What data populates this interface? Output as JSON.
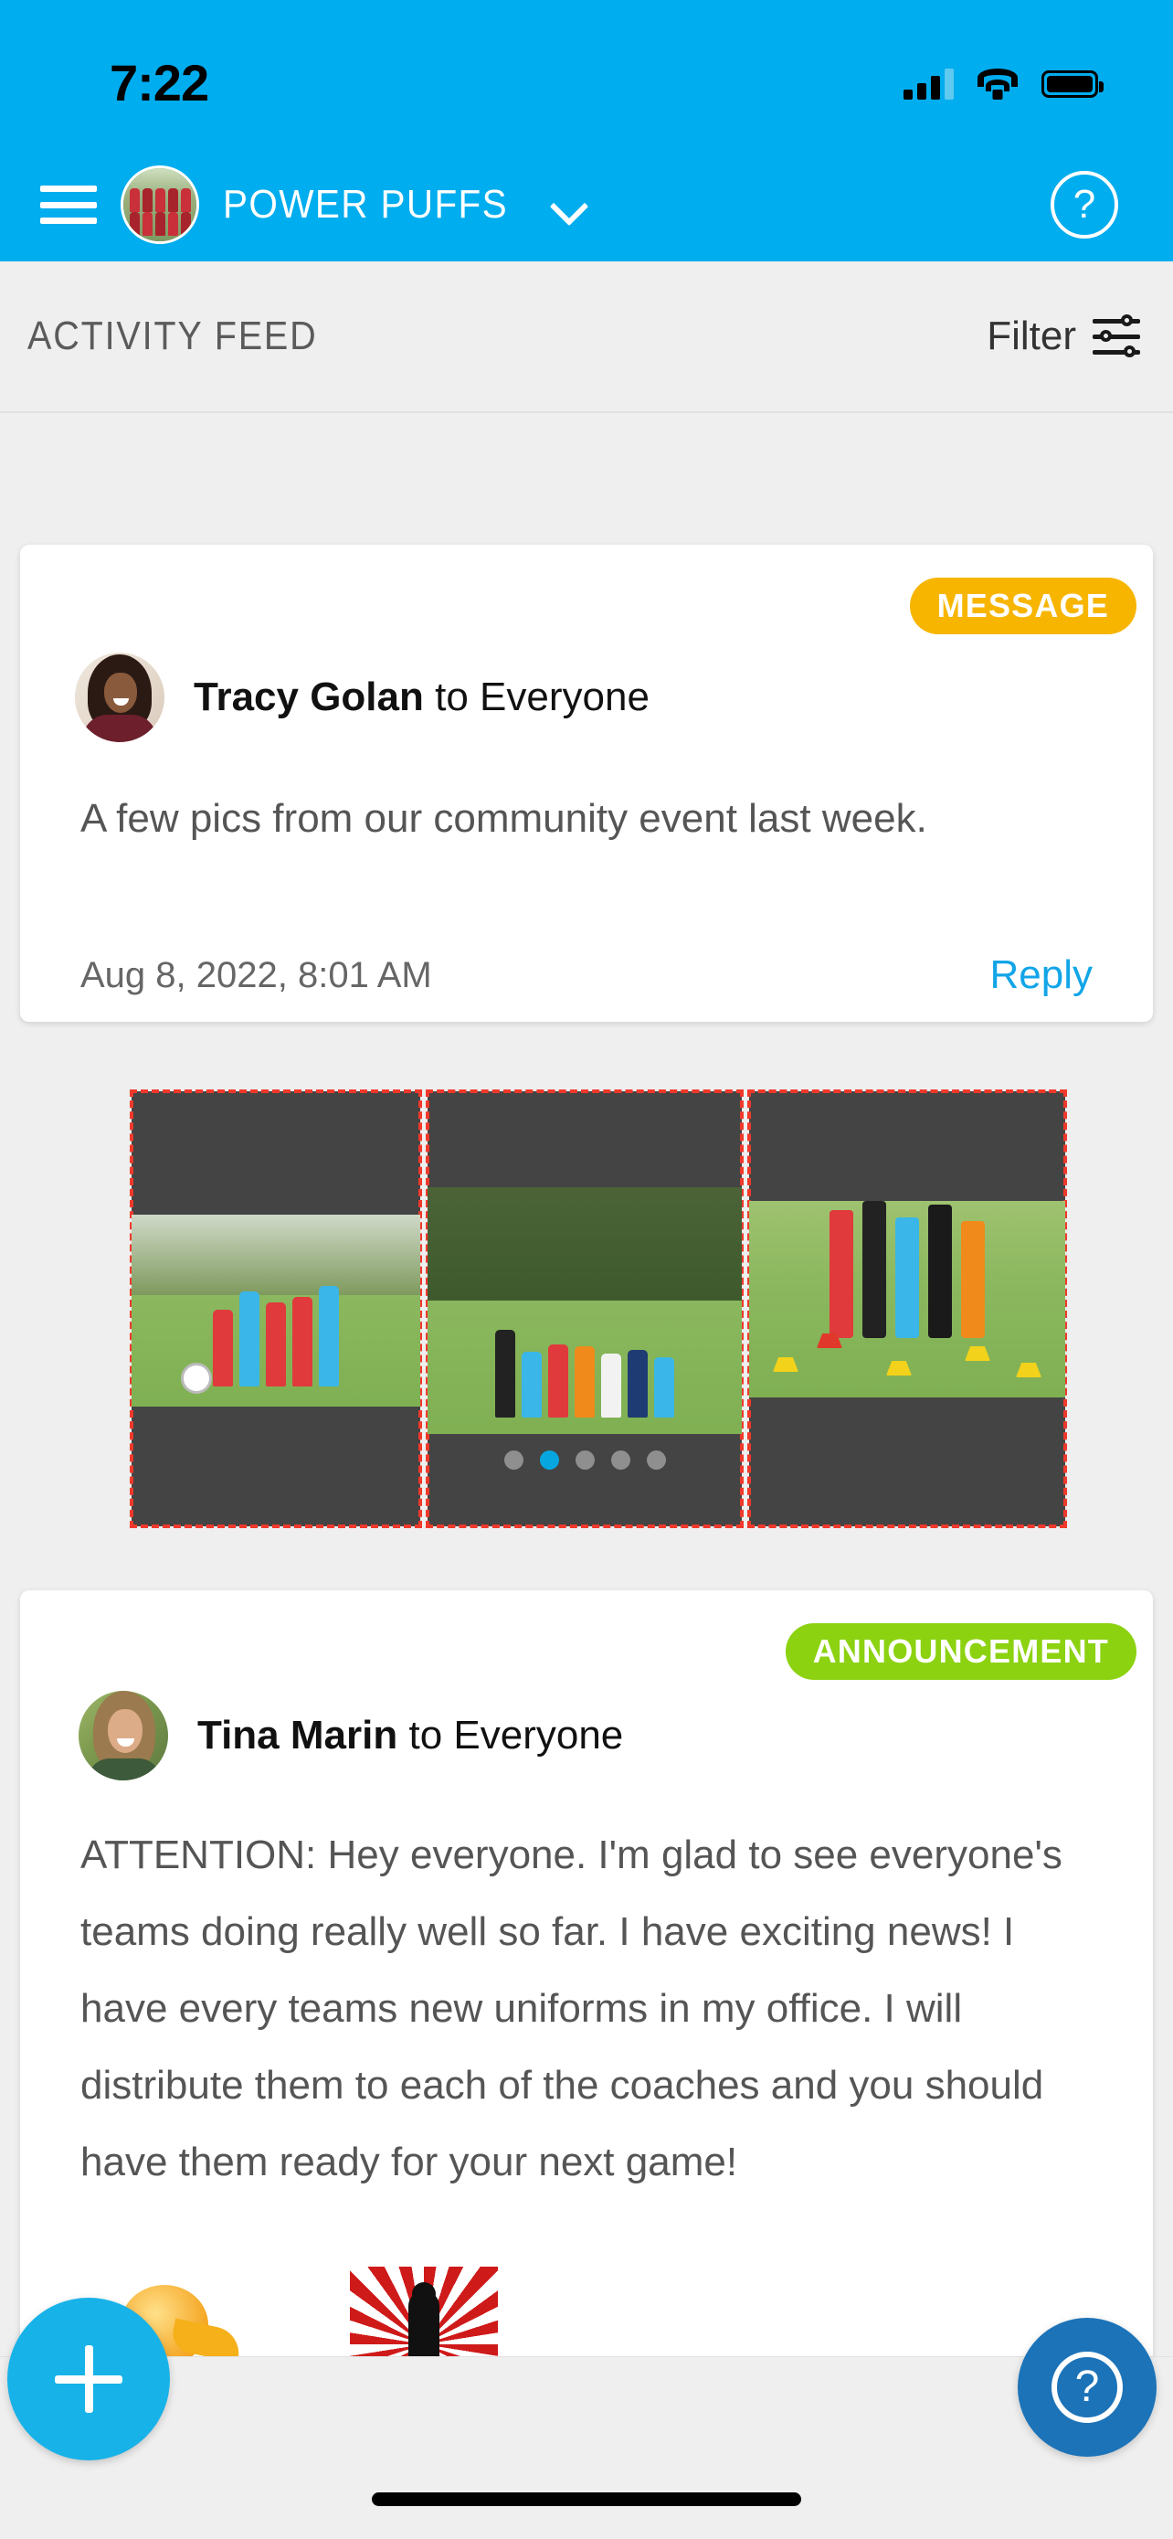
{
  "status_bar": {
    "time": "7:22",
    "signal_icon": "cellular-signal-icon",
    "signal_bars_filled": 3,
    "signal_bars_total": 4,
    "wifi_icon": "wifi-icon",
    "battery_icon": "battery-full-icon"
  },
  "header": {
    "menu_icon": "hamburger-menu-icon",
    "team_avatar": "team-photo-avatar",
    "team_name": "POWER PUFFS",
    "dropdown_icon": "chevron-down-icon",
    "help_icon": "help-circle-icon",
    "background_color": "#00ADEE"
  },
  "feed_bar": {
    "title": "ACTIVITY FEED",
    "filter_label": "Filter",
    "filter_icon": "tune-sliders-icon"
  },
  "posts": [
    {
      "badge": "MESSAGE",
      "badge_color": "#F7B500",
      "author": "Tracy Golan",
      "recipient": "to Everyone",
      "avatar": "tracy-golan-avatar",
      "body": "A few pics from our community event last week.",
      "timestamp": "Aug 8, 2022, 8:01 AM",
      "reply_label": "Reply",
      "reply_color": "#12A5E8",
      "carousel": {
        "slide_count": 5,
        "active_index": 1,
        "visible_slides": [
          "youth-soccer-players-running-photo",
          "youth-teams-lined-up-on-field-photo",
          "soccer-drill-with-cones-photo"
        ]
      }
    },
    {
      "badge": "ANNOUNCEMENT",
      "badge_color": "#8CD211",
      "author": "Tina Marin",
      "recipient": "to Everyone",
      "avatar": "tina-marin-avatar",
      "body": "ATTENTION: Hey everyone. I'm glad to see everyone's teams doing really well so far. I have exciting news! I have every teams new uniforms in my office. I will distribute them to each of the coaches and you should have them ready for your next game!",
      "attachments": [
        "orange-emoji-sticker",
        "red-starburst-silhouette-sticker"
      ]
    }
  ],
  "bottom_bar": {
    "add_button_icon": "plus-icon",
    "add_button_color": "#17B2E8",
    "help_button_icon": "question-mark-circle-icon",
    "help_button_color": "#1C73B8",
    "home_indicator": "home-indicator-bar"
  }
}
